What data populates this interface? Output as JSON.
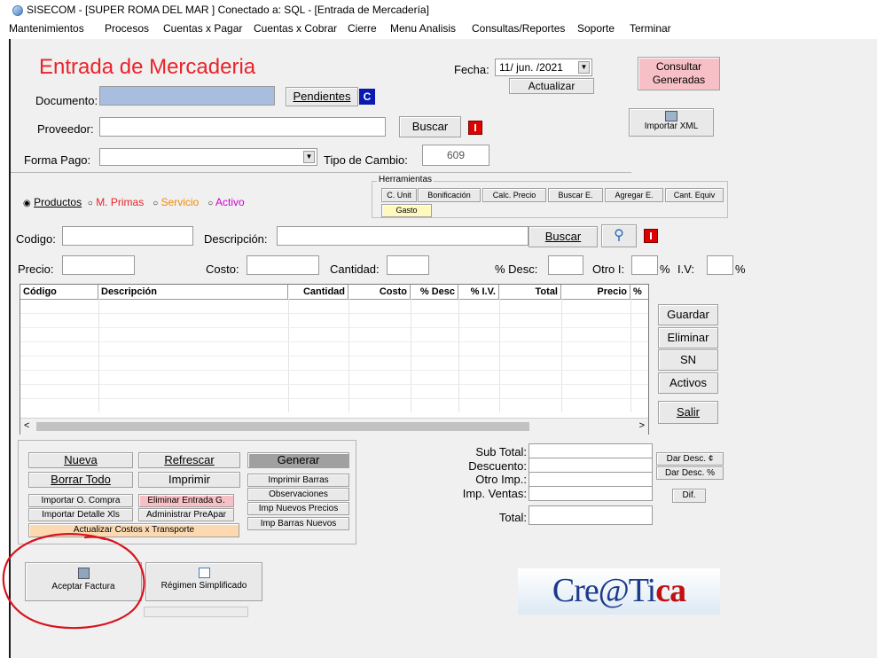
{
  "window": {
    "title": "SISECOM - [SUPER ROMA DEL MAR ] Conectado a: SQL - [Entrada de Mercadería]"
  },
  "menu": [
    "Mantenimientos",
    "Procesos",
    "Cuentas x Pagar",
    "Cuentas x Cobrar",
    "Cierre",
    "Menu Analisis",
    "Consultas/Reportes",
    "Soporte",
    "Terminar"
  ],
  "form": {
    "heading": "Entrada de Mercaderia",
    "fecha_label": "Fecha:",
    "fecha_value": "11/ jun. /2021",
    "actualizar": "Actualizar",
    "consultar_generadas": "Consultar Generadas",
    "importar_xml": "Importar XML",
    "documento_label": "Documento:",
    "pendientes": "Pendientes",
    "c_badge": "C",
    "proveedor_label": "Proveedor:",
    "buscar": "Buscar",
    "forma_pago_label": "Forma Pago:",
    "tipo_cambio_label": "Tipo de Cambio:",
    "tipo_cambio_value": "609",
    "herramientas_label": "Herramientas",
    "herramientas": [
      "C. Unit",
      "Bonificación",
      "Calc. Precio",
      "Buscar E.",
      "Agregar E.",
      "Cant. Equiv"
    ],
    "gasto": "Gasto",
    "radio_productos": "Productos",
    "radio_mprimas": "M. Primas",
    "radio_servicio": "Servicio",
    "radio_activo": "Activo",
    "codigo_label": "Codigo:",
    "descripcion_label": "Descripción:",
    "buscar2": "Buscar",
    "precio_label": "Precio:",
    "costo_label": "Costo:",
    "cantidad_label": "Cantidad:",
    "desc_label": "% Desc:",
    "otro_i_label": "Otro I:",
    "pct": "%",
    "iv_label": "I.V:",
    "pct2": "%"
  },
  "grid": {
    "columns": [
      "Código",
      "Descripción",
      "Cantidad",
      "Costo",
      "% Desc",
      "% I.V.",
      "Total",
      "Precio",
      "% "
    ]
  },
  "side_buttons": [
    "Guardar",
    "Eliminar",
    "SN",
    "Activos",
    "Salir"
  ],
  "actions": {
    "nueva": "Nueva",
    "refrescar": "Refrescar",
    "generar": "Generar",
    "borrar_todo": "Borrar Todo",
    "imprimir": "Imprimir",
    "imprimir_barras": "Imprimir Barras",
    "observaciones": "Observaciones",
    "importar_o_compra": "Importar O. Compra",
    "eliminar_entrada": "Eliminar Entrada G.",
    "imp_nuevos_precios": "Imp Nuevos Precios",
    "importar_detalle": "Importar Detalle Xls",
    "administrar_preapar": "Administrar PreApar",
    "imp_barras_nuevos": "Imp Barras Nuevos",
    "actualizar_costos": "Actualizar Costos x Transporte"
  },
  "totals": {
    "sub_total": "Sub Total:",
    "descuento": "Descuento:",
    "otro_imp": "Otro Imp.:",
    "imp_ventas": "Imp. Ventas:",
    "total": "Total:",
    "dar_desc_c": "Dar Desc. ¢",
    "dar_desc_pct": "Dar Desc. %",
    "dif": "Dif."
  },
  "bottom": {
    "aceptar_factura": "Aceptar Factura",
    "regimen_simplificado": "Régimen Simplificado"
  },
  "logo": {
    "text_a": "Cre@Ti",
    "text_b": "ca"
  },
  "colors": {
    "heading": "#e8242a",
    "pink_button": "#f7c0c6",
    "gasto": "#fff9c0",
    "annotation": "#d7131d",
    "orange_button": "#fcd9b0"
  }
}
